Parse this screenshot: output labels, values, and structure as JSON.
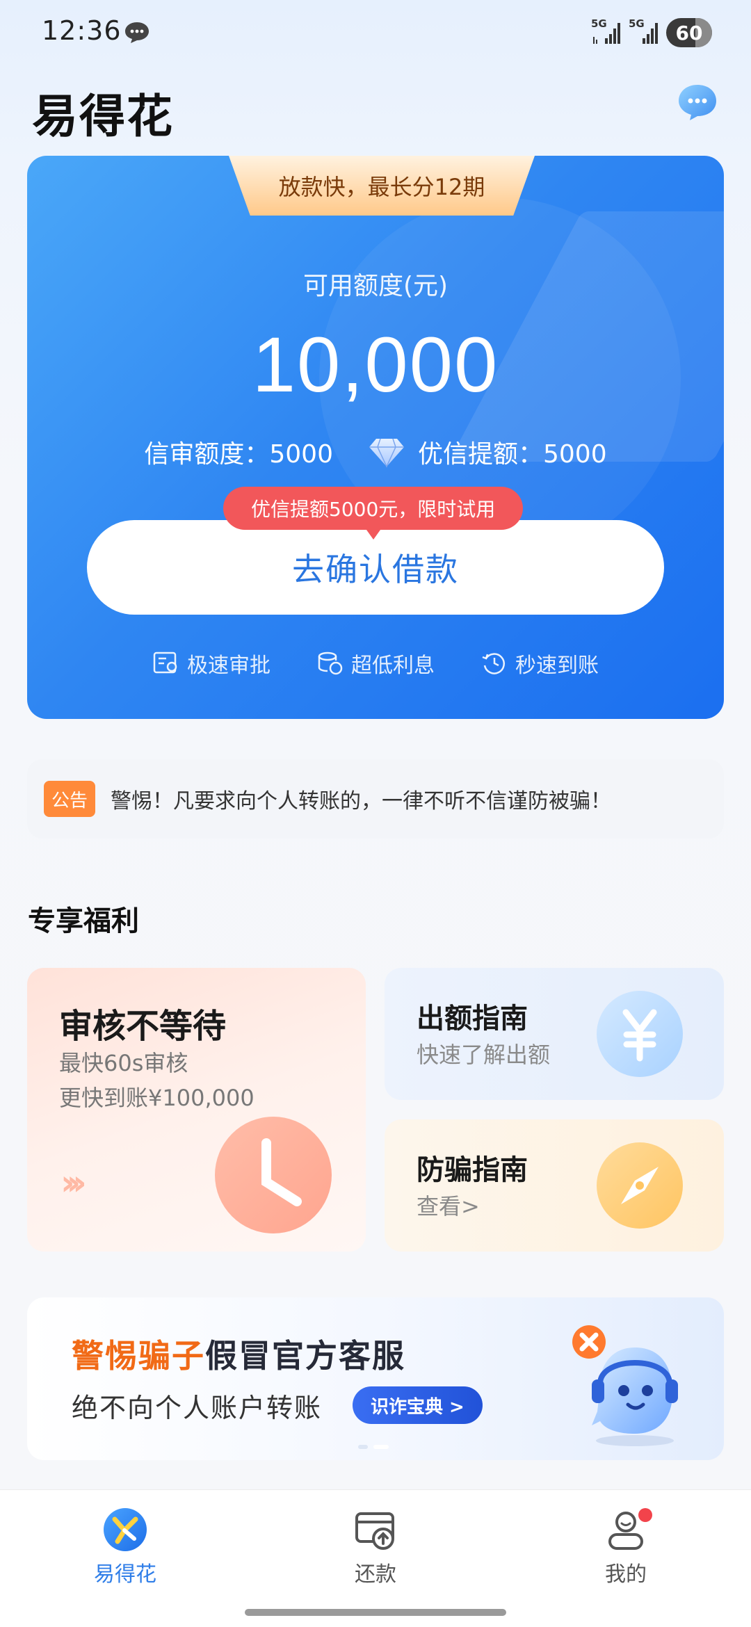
{
  "status_bar": {
    "time": "12:36",
    "network1": "5G",
    "network2": "5G",
    "battery": "60"
  },
  "header": {
    "title": "易得花"
  },
  "hero": {
    "badge": "放款快，最长分12期",
    "available_label": "可用额度(元)",
    "available_amount": "10,000",
    "credit_limit": "信审额度：5000",
    "premium_limit": "优信提额：5000",
    "promo_tag": "优信提额5000元，限时试用",
    "confirm_button": "去确认借款",
    "features": [
      "极速审批",
      "超低利息",
      "秒速到账"
    ]
  },
  "notice": {
    "tag": "公告",
    "text": "警惕！凡要求向个人转账的，一律不听不信谨防被骗！"
  },
  "benefits": {
    "section_title": "专享福利",
    "big_card": {
      "title": "审核不等待",
      "line1": "最快60s审核",
      "line2": "更快到账¥100,000"
    },
    "guide_card": {
      "title": "出额指南",
      "subtitle": "快速了解出额"
    },
    "fraud_card": {
      "title": "防骗指南",
      "subtitle": "查看>"
    }
  },
  "banner": {
    "warn_text": "警惕骗子",
    "rest_text": "假冒官方客服",
    "line2": "绝不向个人账户转账",
    "button": "识诈宝典 >"
  },
  "bottom_nav": {
    "home": "易得花",
    "repay": "还款",
    "mine": "我的"
  },
  "colors": {
    "primary": "#2f86f2",
    "accent_orange": "#ff8a3a",
    "promo_red": "#f2575a"
  }
}
